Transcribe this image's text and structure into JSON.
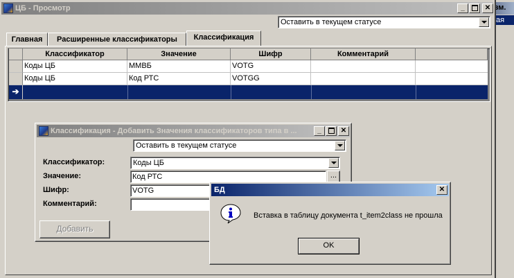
{
  "main_window": {
    "title": "ЦБ - Просмотр",
    "status_combo": "Оставить в текущем статусе",
    "tabs": [
      {
        "label": "Главная"
      },
      {
        "label": "Расширенные классификаторы"
      },
      {
        "label": "Классификация"
      }
    ],
    "grid": {
      "headers": [
        "Классификатор",
        "Значение",
        "Шифр",
        "Комментарий"
      ],
      "rows": [
        [
          "Коды ЦБ",
          "ММВБ",
          "VOTG",
          ""
        ],
        [
          "Коды ЦБ",
          "Код РТС",
          "VOTGG",
          ""
        ]
      ],
      "current_row_marker": "➔"
    }
  },
  "background_window": {
    "title_fragment": "зм.",
    "list_fragment": "ая"
  },
  "add_dialog": {
    "title": "Классификация - Добавить Значения классификаторов типа в ...",
    "status_combo": "Оставить в текущем статусе",
    "fields": {
      "classifier_label": "Классификатор:",
      "classifier_value": "Коды ЦБ",
      "value_label": "Значение:",
      "value_value": "Код РТС",
      "cipher_label": "Шифр:",
      "cipher_value": "VOTG",
      "comment_label": "Комментарий:",
      "comment_value": ""
    },
    "ellipsis": "...",
    "add_button": "Добавить"
  },
  "error_dialog": {
    "title": "БД",
    "message": "Вставка в таблицу документа t_item2class не прошла",
    "ok_button": "OK",
    "icon": "info-icon"
  },
  "colors": {
    "active_title": "#0a246a",
    "inactive_title": "#808080",
    "selected_row": "#0a246a",
    "face": "#d4d0c8"
  }
}
